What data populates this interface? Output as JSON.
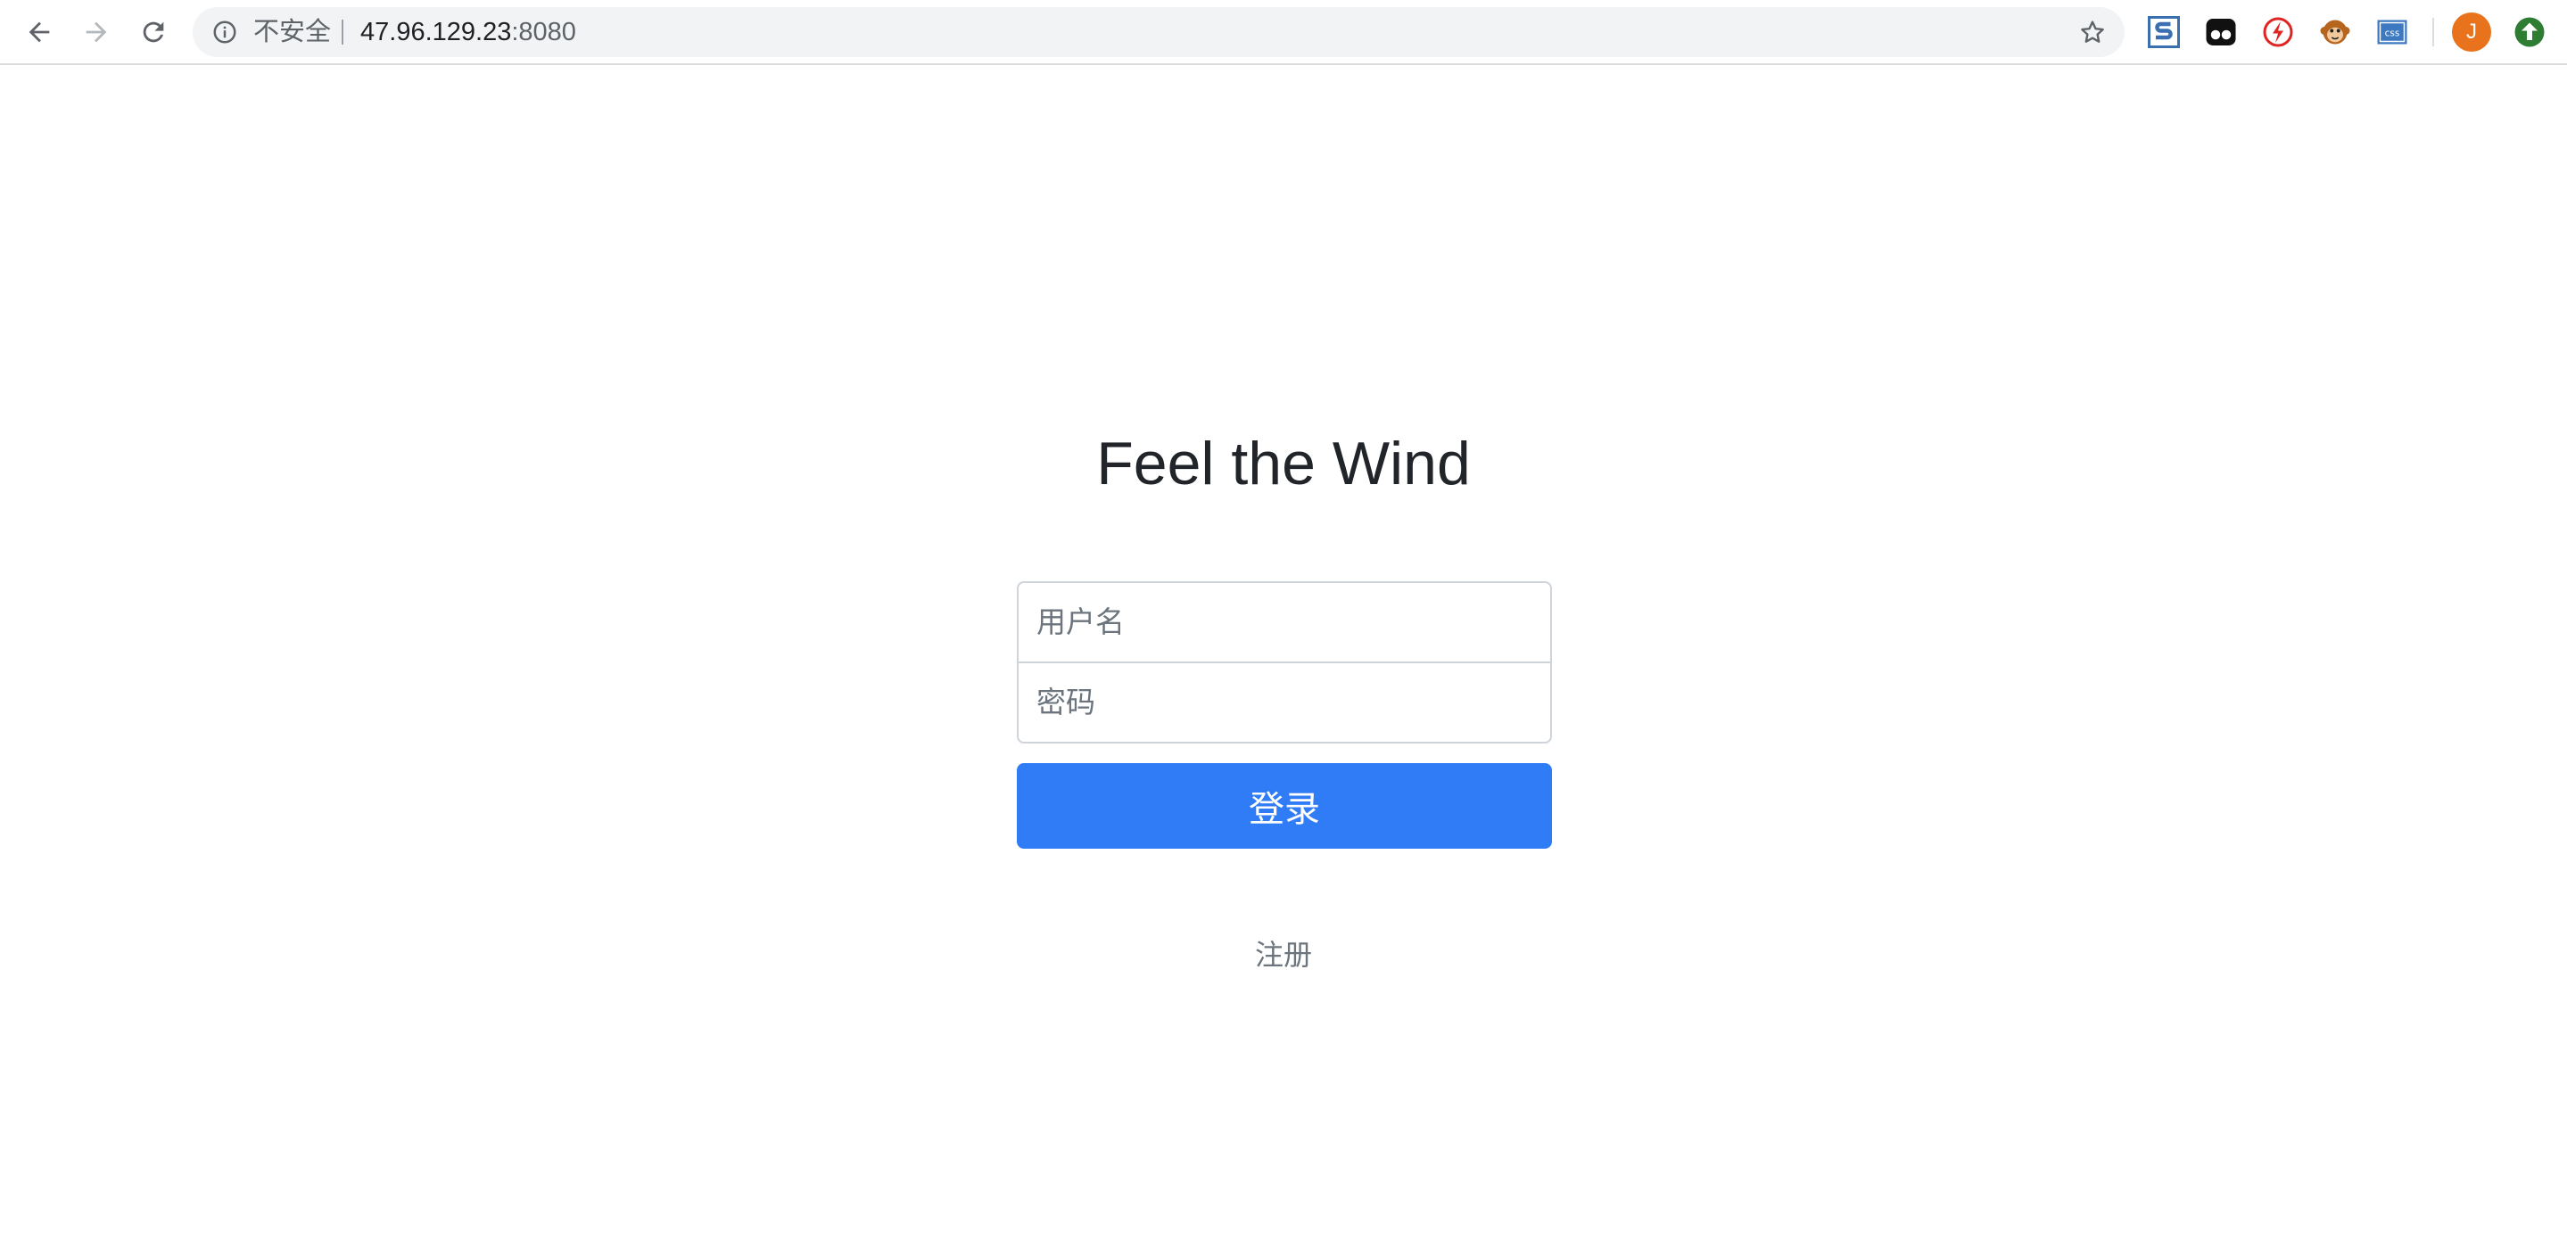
{
  "browser": {
    "security_label": "不安全",
    "url_host": "47.96.129.23",
    "url_port": ":8080",
    "profile_initial": "J",
    "extensions": [
      "s-extension-icon",
      "eyes-extension-icon",
      "flash-extension-icon",
      "monkey-extension-icon",
      "css-extension-icon"
    ]
  },
  "page": {
    "title": "Feel the Wind",
    "login_form": {
      "username_placeholder": "用户名",
      "username_value": "",
      "password_placeholder": "密码",
      "password_value": "",
      "submit_label": "登录"
    },
    "register_label": "注册"
  },
  "colors": {
    "primary": "#2f7cf6",
    "avatar": "#e8731c",
    "update": "#2e7d32"
  }
}
